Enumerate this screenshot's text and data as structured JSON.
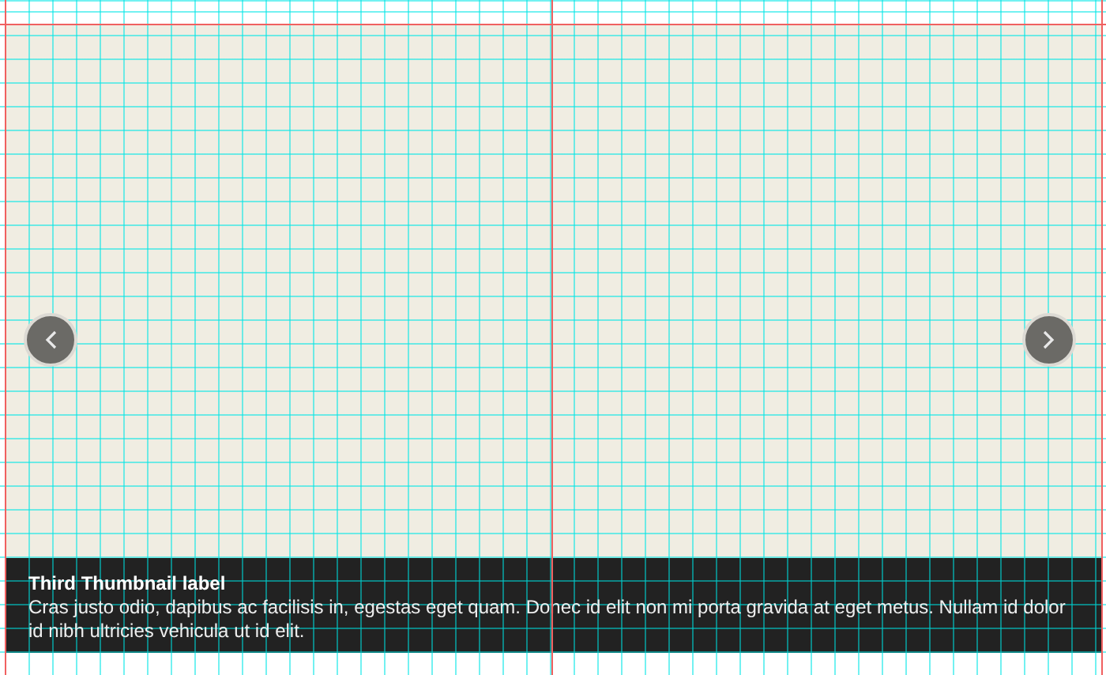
{
  "carousel": {
    "caption": {
      "title": "Third Thumbnail label",
      "text": "Cras justo odio, dapibus ac facilisis in, egestas eget quam. Donec id elit non mi porta gravida at eget metus. Nullam id dolor id nibh ultricies vehicula ut id elit."
    }
  }
}
